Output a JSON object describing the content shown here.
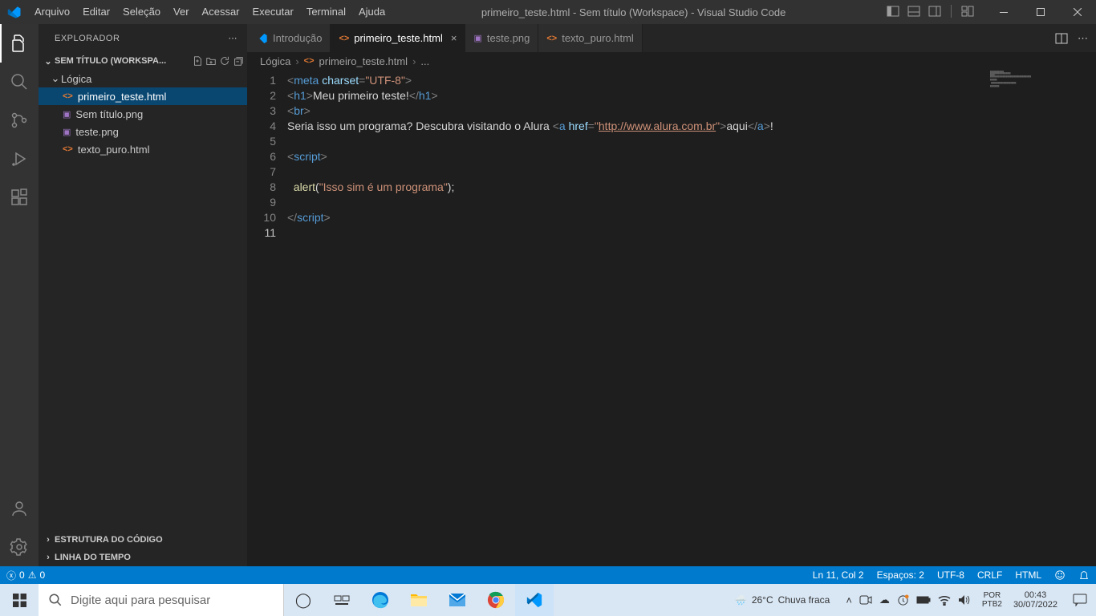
{
  "titlebar": {
    "menu": [
      "Arquivo",
      "Editar",
      "Seleção",
      "Ver",
      "Acessar",
      "Executar",
      "Terminal",
      "Ajuda"
    ],
    "title": "primeiro_teste.html - Sem título (Workspace) - Visual Studio Code"
  },
  "sidebar": {
    "title": "EXPLORADOR",
    "workspace": "SEM TÍTULO (WORKSPA...",
    "folder": "Lógica",
    "files": [
      {
        "name": "primeiro_teste.html",
        "kind": "html",
        "selected": true
      },
      {
        "name": "Sem título.png",
        "kind": "png",
        "selected": false
      },
      {
        "name": "teste.png",
        "kind": "png",
        "selected": false
      },
      {
        "name": "texto_puro.html",
        "kind": "html",
        "selected": false
      }
    ],
    "outline": "ESTRUTURA DO CÓDIGO",
    "timeline": "LINHA DO TEMPO"
  },
  "tabs": [
    {
      "label": "Introdução",
      "icon": "vscode",
      "active": false,
      "close": false
    },
    {
      "label": "primeiro_teste.html",
      "icon": "html",
      "active": true,
      "close": true
    },
    {
      "label": "teste.png",
      "icon": "png",
      "active": false,
      "close": false
    },
    {
      "label": "texto_puro.html",
      "icon": "html",
      "active": false,
      "close": false
    }
  ],
  "breadcrumb": {
    "folder": "Lógica",
    "file": "primeiro_teste.html",
    "more": "..."
  },
  "code": {
    "lines": 11,
    "current": 11,
    "l1": {
      "charset": "UTF-8"
    },
    "l2": {
      "text": "Meu primeiro teste!"
    },
    "l4": {
      "text_before": "Seria isso um programa? Descubra visitando o Alura ",
      "href": "http://www.alura.com.br",
      "link_text": "aqui",
      "after": "!"
    },
    "l8": {
      "fn": "alert",
      "arg": "Isso sim é um programa"
    }
  },
  "status": {
    "errors": "0",
    "warnings": "0",
    "ln_col": "Ln 11, Col 2",
    "spaces": "Espaços: 2",
    "encoding": "UTF-8",
    "eol": "CRLF",
    "lang": "HTML"
  },
  "taskbar": {
    "search_placeholder": "Digite aqui para pesquisar",
    "weather_temp": "26°C",
    "weather_text": "Chuva fraca",
    "lang1": "POR",
    "lang2": "PTB2",
    "time": "00:43",
    "date": "30/07/2022"
  }
}
